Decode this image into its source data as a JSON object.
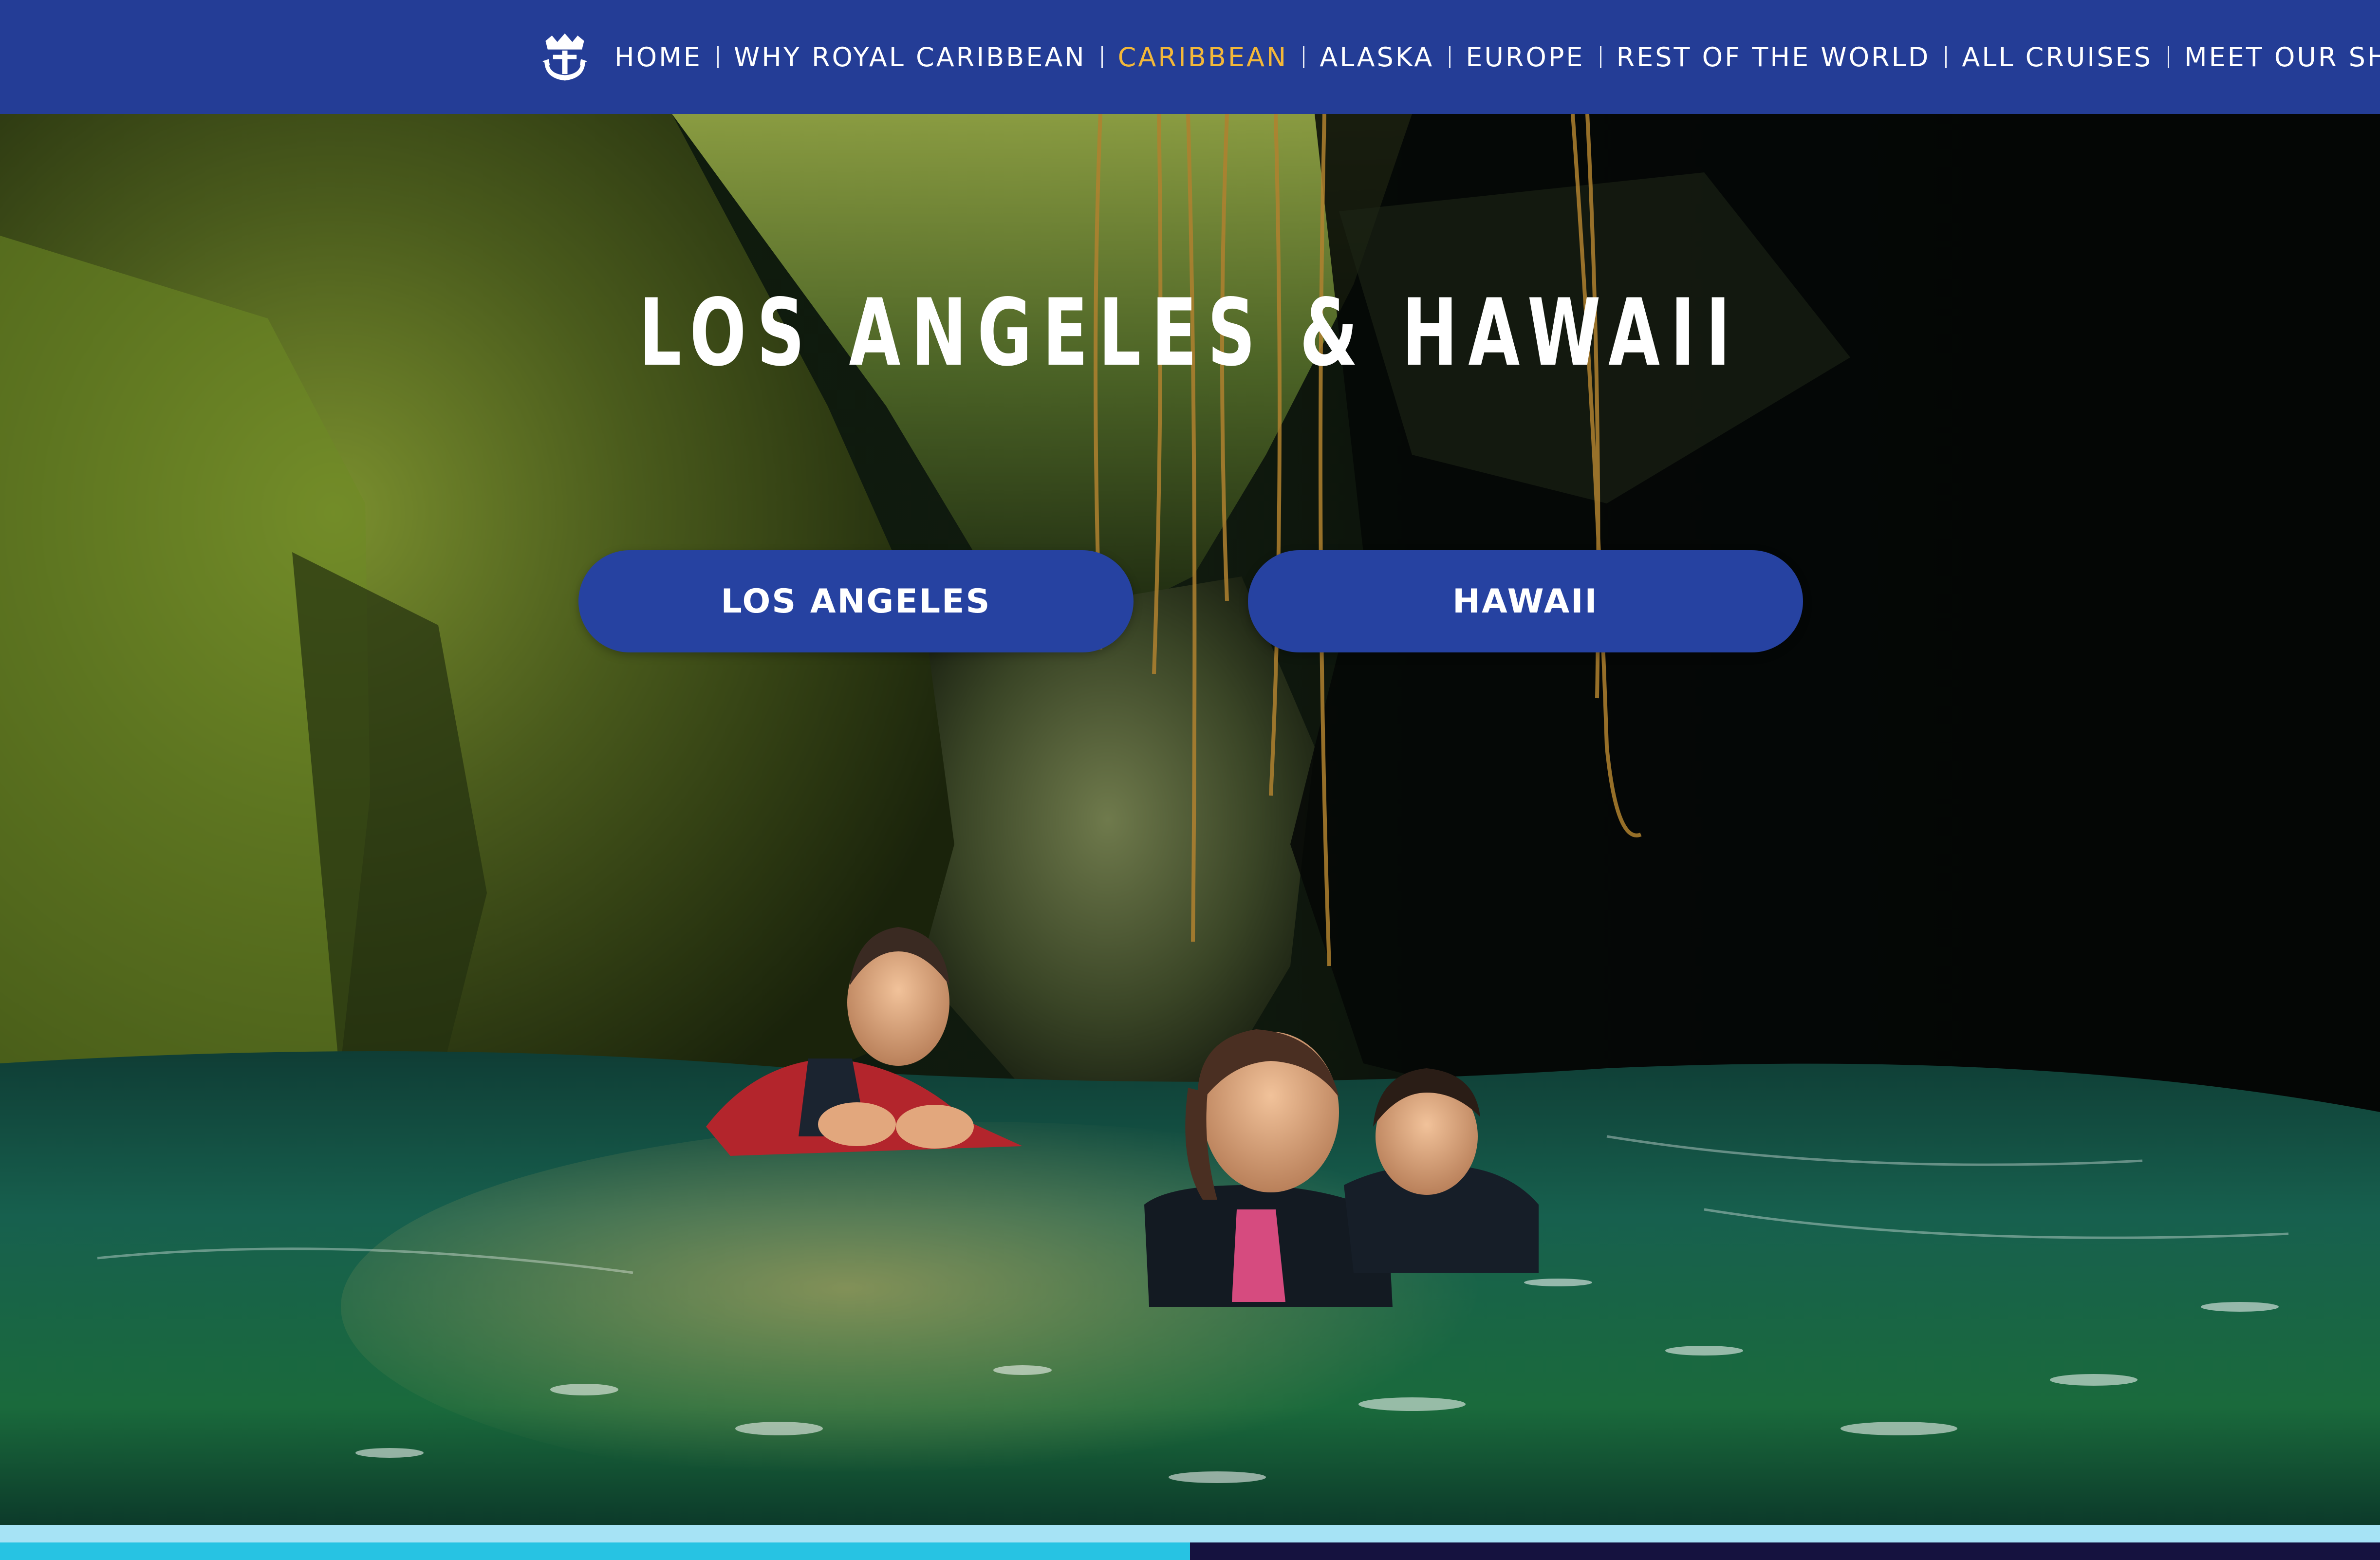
{
  "nav": {
    "logo_icon": "crown-anchor-logo-icon",
    "items": [
      {
        "label": "HOME",
        "active": false
      },
      {
        "label": "WHY ROYAL CARIBBEAN",
        "active": false
      },
      {
        "label": "CARIBBEAN",
        "active": true
      },
      {
        "label": "ALASKA",
        "active": false
      },
      {
        "label": "EUROPE",
        "active": false
      },
      {
        "label": "REST OF THE WORLD",
        "active": false
      },
      {
        "label": "ALL CRUISES",
        "active": false
      },
      {
        "label": "MEET OUR SHIPS",
        "active": false
      }
    ]
  },
  "hero": {
    "title": "LOS ANGELES & HAWAII",
    "buttons": {
      "los_angeles": "LOS ANGELES",
      "hawaii": "HAWAII"
    }
  },
  "colors": {
    "nav_background": "#243d96",
    "active_nav": "#f3b839",
    "button_background": "#2642a1",
    "strip_light": "#a6e3f5",
    "strip_cyan": "#27c3e3",
    "strip_navy": "#15123f"
  }
}
